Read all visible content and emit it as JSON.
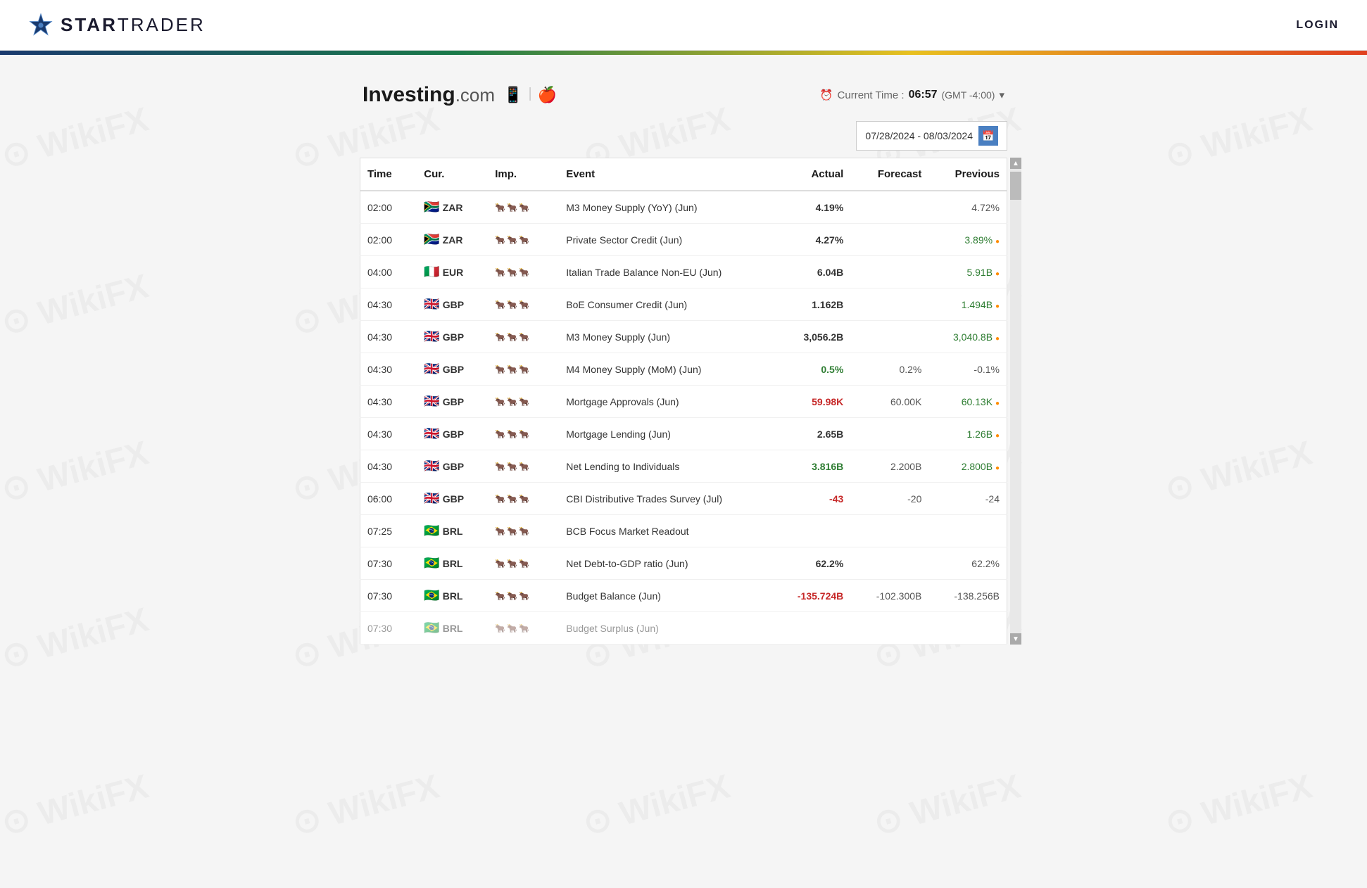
{
  "header": {
    "logo_star": "✦",
    "logo_brand": "STAR",
    "logo_suffix": "TRADER",
    "login_label": "LOGIN"
  },
  "investing": {
    "logo_text": "Investing",
    "logo_dotcom": ".com",
    "android_icon": "🤖",
    "apple_icon": "",
    "clock_icon": "🕐",
    "current_time_label": "Current Time :",
    "current_time_value": "06:57",
    "timezone": "(GMT -4:00)",
    "date_range": "07/28/2024 - 08/03/2024"
  },
  "table": {
    "headers": {
      "time": "Time",
      "currency": "Cur.",
      "importance": "Imp.",
      "event": "Event",
      "actual": "Actual",
      "forecast": "Forecast",
      "previous": "Previous"
    },
    "rows": [
      {
        "time": "02:00",
        "flag": "🇿🇦",
        "currency": "ZAR",
        "importance": 1,
        "event": "M3 Money Supply (YoY) (Jun)",
        "actual": "4.19%",
        "actual_color": "black",
        "forecast": "",
        "previous": "4.72%",
        "previous_color": "black",
        "dot": false
      },
      {
        "time": "02:00",
        "flag": "🇿🇦",
        "currency": "ZAR",
        "importance": 1,
        "event": "Private Sector Credit (Jun)",
        "actual": "4.27%",
        "actual_color": "black",
        "forecast": "",
        "previous": "3.89%",
        "previous_color": "green",
        "dot": true
      },
      {
        "time": "04:00",
        "flag": "🇮🇹",
        "currency": "EUR",
        "importance": 1,
        "event": "Italian Trade Balance Non-EU (Jun)",
        "actual": "6.04B",
        "actual_color": "black",
        "forecast": "",
        "previous": "5.91B",
        "previous_color": "green",
        "dot": true
      },
      {
        "time": "04:30",
        "flag": "🇬🇧",
        "currency": "GBP",
        "importance": 1,
        "event": "BoE Consumer Credit (Jun)",
        "actual": "1.162B",
        "actual_color": "black",
        "forecast": "",
        "previous": "1.494B",
        "previous_color": "green",
        "dot": true
      },
      {
        "time": "04:30",
        "flag": "🇬🇧",
        "currency": "GBP",
        "importance": 1,
        "event": "M3 Money Supply (Jun)",
        "actual": "3,056.2B",
        "actual_color": "black",
        "forecast": "",
        "previous": "3,040.8B",
        "previous_color": "green",
        "dot": true
      },
      {
        "time": "04:30",
        "flag": "🇬🇧",
        "currency": "GBP",
        "importance": 1,
        "event": "M4 Money Supply (MoM) (Jun)",
        "actual": "0.5%",
        "actual_color": "green",
        "forecast": "0.2%",
        "previous": "-0.1%",
        "previous_color": "black",
        "dot": false
      },
      {
        "time": "04:30",
        "flag": "🇬🇧",
        "currency": "GBP",
        "importance": 1,
        "event": "Mortgage Approvals (Jun)",
        "actual": "59.98K",
        "actual_color": "red",
        "forecast": "60.00K",
        "previous": "60.13K",
        "previous_color": "green",
        "dot": true
      },
      {
        "time": "04:30",
        "flag": "🇬🇧",
        "currency": "GBP",
        "importance": 1,
        "event": "Mortgage Lending (Jun)",
        "actual": "2.65B",
        "actual_color": "black",
        "forecast": "",
        "previous": "1.26B",
        "previous_color": "green",
        "dot": true
      },
      {
        "time": "04:30",
        "flag": "🇬🇧",
        "currency": "GBP",
        "importance": 1,
        "event": "Net Lending to Individuals",
        "actual": "3.816B",
        "actual_color": "green",
        "forecast": "2.200B",
        "previous": "2.800B",
        "previous_color": "green",
        "dot": true
      },
      {
        "time": "06:00",
        "flag": "🇬🇧",
        "currency": "GBP",
        "importance": 1,
        "event": "CBI Distributive Trades Survey (Jul)",
        "actual": "-43",
        "actual_color": "red",
        "forecast": "-20",
        "previous": "-24",
        "previous_color": "black",
        "dot": false
      },
      {
        "time": "07:25",
        "flag": "🇧🇷",
        "currency": "BRL",
        "importance": 1,
        "event": "BCB Focus Market Readout",
        "actual": "",
        "actual_color": "black",
        "forecast": "",
        "previous": "",
        "previous_color": "black",
        "dot": false
      },
      {
        "time": "07:30",
        "flag": "🇧🇷",
        "currency": "BRL",
        "importance": 1,
        "event": "Net Debt-to-GDP ratio (Jun)",
        "actual": "62.2%",
        "actual_color": "black",
        "forecast": "",
        "previous": "62.2%",
        "previous_color": "black",
        "dot": false
      },
      {
        "time": "07:30",
        "flag": "🇧🇷",
        "currency": "BRL",
        "importance": 1,
        "event": "Budget Balance (Jun)",
        "actual": "-135.724B",
        "actual_color": "red",
        "forecast": "-102.300B",
        "previous": "-138.256B",
        "previous_color": "black",
        "dot": false
      },
      {
        "time": "07:30",
        "flag": "🇧🇷",
        "currency": "BRL",
        "importance": 1,
        "event": "Budget Surplus (Jun)",
        "actual": "",
        "actual_color": "black",
        "forecast": "",
        "previous": "",
        "previous_color": "black",
        "dot": false,
        "partial": true
      }
    ]
  }
}
